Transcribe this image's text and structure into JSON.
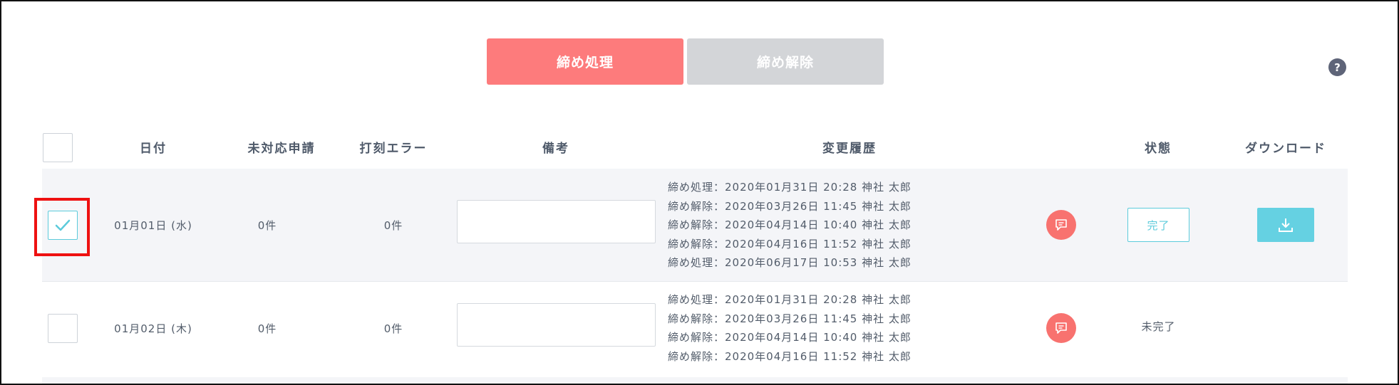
{
  "toolbar": {
    "close_label": "締め処理",
    "release_label": "締め解除",
    "help_label": "?"
  },
  "table": {
    "headers": {
      "date": "日付",
      "pending": "未対応申請",
      "clock_error": "打刻エラー",
      "memo": "備考",
      "history": "変更履歴",
      "status": "状態",
      "download": "ダウンロード"
    },
    "rows": [
      {
        "checked": true,
        "date": "01月01日 (水)",
        "pending": "0件",
        "clock_error": "0件",
        "memo": "",
        "history": [
          "締め処理：2020年01月31日 20:28 神社 太郎",
          "締め解除：2020年03月26日 11:45 神社 太郎",
          "締め解除：2020年04月14日 10:40 神社 太郎",
          "締め解除：2020年04月16日 11:52 神社 太郎",
          "締め処理：2020年06月17日 10:53 神社 太郎"
        ],
        "status": "完了"
      },
      {
        "checked": false,
        "date": "01月02日 (木)",
        "pending": "0件",
        "clock_error": "0件",
        "memo": "",
        "history": [
          "締め処理：2020年01月31日 20:28 神社 太郎",
          "締め解除：2020年03月26日 11:45 神社 太郎",
          "締め解除：2020年04月14日 10:40 神社 太郎",
          "締め解除：2020年04月16日 11:52 神社 太郎"
        ],
        "status": "未完了"
      }
    ]
  },
  "colors": {
    "accent_red": "#fd7b7c",
    "disabled_gray": "#d3d5d8",
    "accent_cyan": "#65d1e2",
    "highlight_red": "#ee1111"
  },
  "icons": {
    "help": "question-circle-icon",
    "check": "checkmark-icon",
    "comment": "chat-bubble-icon",
    "download": "download-arrow-icon"
  }
}
